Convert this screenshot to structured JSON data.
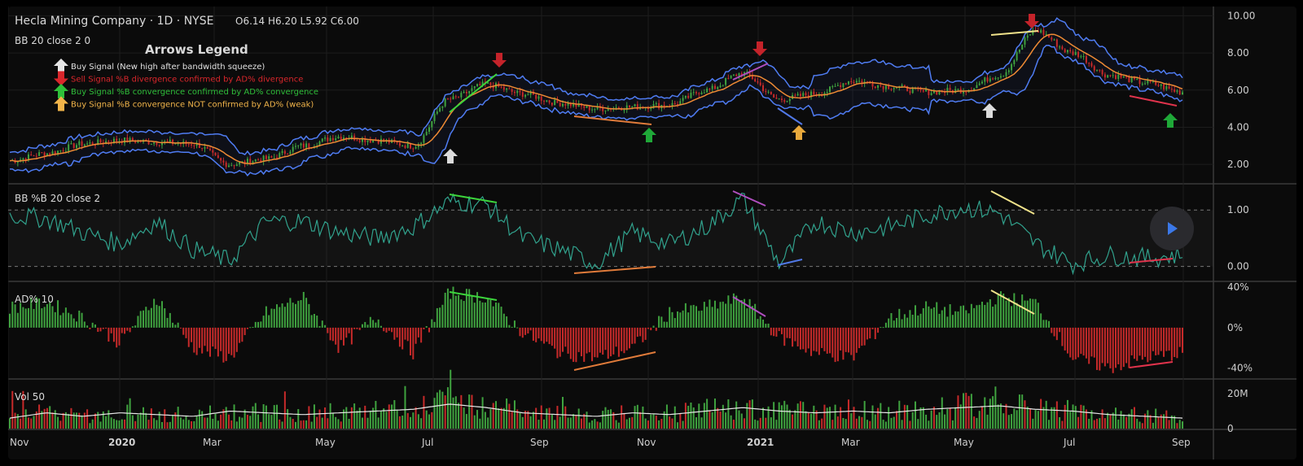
{
  "header": {
    "symbol": "Hecla Mining Company · 1D · NYSE",
    "ohlc": "O6.14  H6.20  L5.92  C6.00",
    "bb_label": "BB 20 close 2 0"
  },
  "legend": {
    "title": "Arrows Legend",
    "items": [
      {
        "color": "#e6e6e6",
        "dir": "up",
        "text": "Buy Signal (New high after bandwidth squeeze)"
      },
      {
        "color": "#d9262b",
        "dir": "down",
        "text": "Sell Signal %B divergence confirmed by AD% divergence"
      },
      {
        "color": "#2fbf3a",
        "dir": "up",
        "text": "Buy Signal %B convergence confirmed by AD% convergence"
      },
      {
        "color": "#f2b54a",
        "dir": "up",
        "text": "Buy Signal %B convergence NOT confirmed by AD% (weak)"
      }
    ]
  },
  "colors": {
    "bg": "#0b0b0b",
    "grid": "#1d1d1d",
    "band": "#4f7cf2",
    "basis": "#ee8a34",
    "up": "#3fa23f",
    "down": "#c72a2a",
    "pctb": "#31a28d",
    "vol_ma": "#e8e8e8",
    "sell": "#c4232a",
    "buy_white": "#dcdcdc",
    "buy_green": "#1fa838",
    "buy_orange": "#e9a93c"
  },
  "chart_data": [
    {
      "type": "line",
      "name": "price",
      "title": "Hecla Mining Company · 1D · NYSE",
      "x": [
        "Nov",
        "2020",
        "Mar",
        "May",
        "Jul",
        "Sep",
        "Nov",
        "2021",
        "Mar",
        "May",
        "Jul",
        "Sep"
      ],
      "ylim": [
        1.0,
        10.5
      ],
      "yticks": [
        "10.00",
        "8.00",
        "6.00",
        "4.00",
        "2.00"
      ],
      "series": [
        {
          "name": "BB 20 close 2 0",
          "values": [
            2.2,
            2.6,
            3.1,
            3.3,
            3.2,
            3.1,
            2.0,
            2.3,
            3.0,
            3.5,
            3.3,
            3.0,
            5.5,
            6.3,
            5.8,
            5.3,
            5.0,
            5.1,
            5.2,
            6.0,
            6.9,
            5.5,
            5.8,
            6.5,
            6.2,
            5.9,
            6.0,
            6.8,
            9.2,
            8.0,
            6.8,
            6.4,
            5.9
          ]
        }
      ],
      "ohlc_last": {
        "open": 6.14,
        "high": 6.2,
        "low": 5.92,
        "close": 6.0
      }
    },
    {
      "type": "line",
      "name": "BB %B 20 close 2",
      "ylim": [
        -0.25,
        1.45
      ],
      "yticks": [
        "1.00",
        "0.00"
      ],
      "values": [
        0.9,
        0.85,
        0.6,
        0.4,
        0.8,
        0.3,
        0.1,
        0.8,
        0.8,
        0.6,
        0.5,
        0.7,
        1.15,
        1.1,
        0.5,
        0.3,
        0.05,
        0.6,
        0.4,
        0.7,
        1.2,
        0.05,
        0.8,
        0.6,
        0.7,
        0.9,
        1.05,
        0.95,
        0.4,
        0.05,
        0.2,
        0.15,
        0.2
      ]
    },
    {
      "type": "bar",
      "name": "AD% 10",
      "ylim": [
        -50,
        45
      ],
      "yticks": [
        "40%",
        "0%",
        "-40%"
      ],
      "values": [
        20,
        25,
        10,
        -15,
        30,
        -20,
        -30,
        15,
        30,
        -20,
        10,
        -25,
        35,
        30,
        -5,
        -25,
        -30,
        -20,
        15,
        20,
        30,
        -10,
        -25,
        -30,
        10,
        20,
        15,
        30,
        25,
        -30,
        -40,
        -30,
        -25
      ]
    },
    {
      "type": "bar",
      "name": "Vol 50",
      "ylim": [
        0,
        26
      ],
      "yticks": [
        "20M",
        "0"
      ],
      "values": [
        6,
        9,
        7,
        9,
        8,
        7,
        10,
        9,
        8,
        9,
        10,
        11,
        14,
        12,
        9,
        8,
        7,
        9,
        8,
        10,
        12,
        10,
        9,
        10,
        9,
        11,
        12,
        13,
        11,
        10,
        8,
        7,
        6
      ]
    }
  ],
  "chart_labels": {
    "pctb_label": "BB %B 20 close 2",
    "ad_label": "AD% 10",
    "vol_label": "Vol 50",
    "x_axis": [
      "Nov",
      "2020",
      "Mar",
      "May",
      "Jul",
      "Sep",
      "Nov",
      "2021",
      "Mar",
      "May",
      "Jul",
      "Sep"
    ]
  },
  "controls": {
    "play_icon": "play-icon"
  }
}
